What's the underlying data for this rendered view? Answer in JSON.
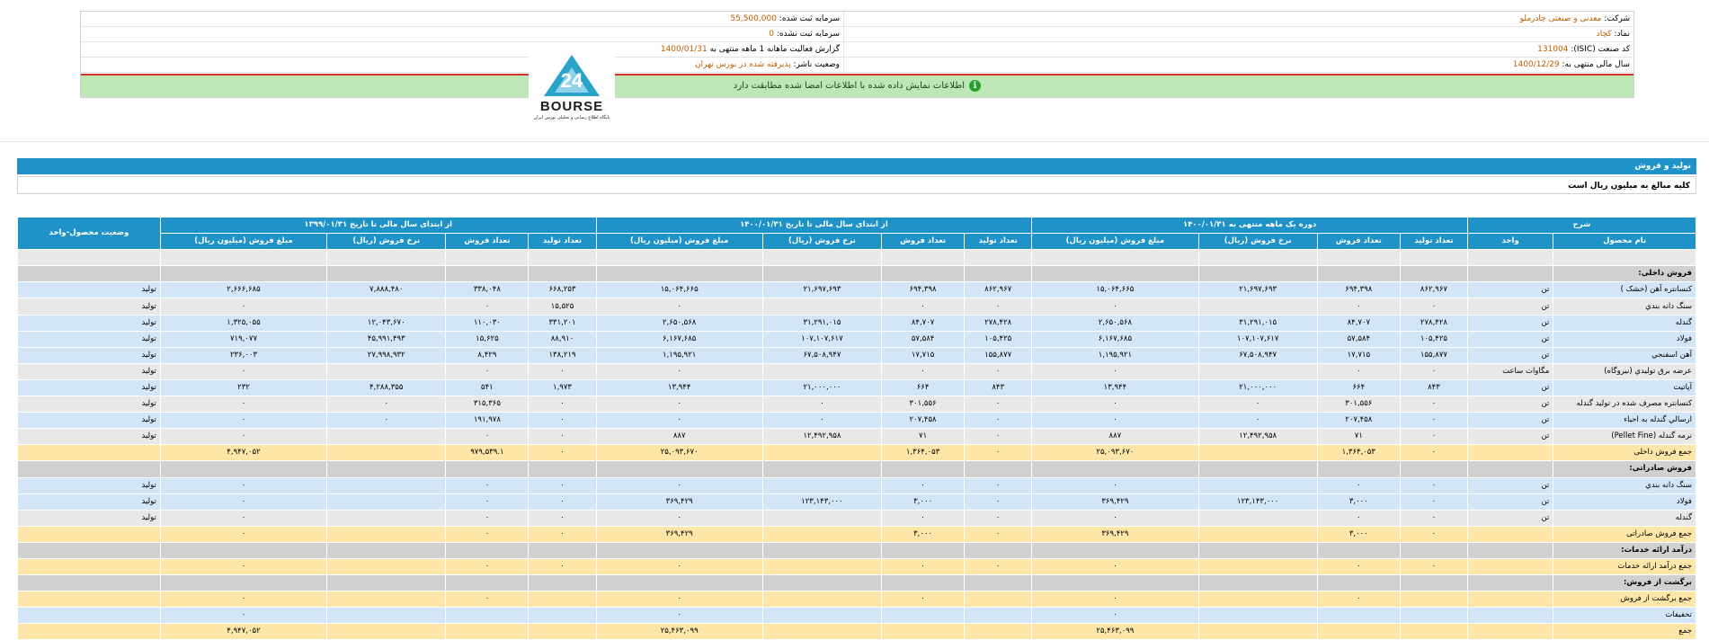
{
  "header": {
    "right": [
      {
        "label": "شرکت:",
        "value": "معدنی و صنعتی چادرملو"
      },
      {
        "label": "نماد:",
        "value": "کچاد"
      },
      {
        "label": "کد صنعت (ISIC):",
        "value": "131004"
      },
      {
        "label": "سال مالی منتهی به:",
        "value": "1400/12/29"
      }
    ],
    "left": [
      {
        "label": "سرمایه ثبت شده:",
        "value": "55,500,000"
      },
      {
        "label": "سرمایه ثبت نشده:",
        "value": "0"
      },
      {
        "label": "گزارش فعالیت ماهانه 1 ماهه منتهی به",
        "value": "1400/01/31"
      },
      {
        "label": "وضعیت ناشر:",
        "value": "پذیرفته شده در بورس تهران"
      }
    ],
    "notice": "اطلاعات نمایش داده شده با اطلاعات امضا شده مطابقت دارد",
    "notice_icon": "info-icon"
  },
  "logo": {
    "text": "BOURSE",
    "sub": "پایگاه اطلاع رسانی و تحلیلی بورس ایران"
  },
  "section_title": "تولید و فروش",
  "amount_note": "کلیه مبالغ به میلیون ریال است",
  "table": {
    "group_headers": [
      "شرح",
      "دوره یک ماهه منتهی به ۱۴۰۰/۰۱/۳۱",
      "از ابتدای سال مالی تا تاریخ ۱۴۰۰/۰۱/۳۱",
      "از ابتدای سال مالی تا تاریخ ۱۳۹۹/۰۱/۳۱",
      "وضعیت محصول-واحد"
    ],
    "sub_headers": [
      "نام محصول",
      "واحد",
      "تعداد تولید",
      "تعداد فروش",
      "نرخ فروش (ریال)",
      "مبلغ فروش (میلیون ریال)",
      "تعداد تولید",
      "تعداد فروش",
      "نرخ فروش (ریال)",
      "مبلغ فروش (میلیون ریال)",
      "تعداد تولید",
      "تعداد فروش",
      "نرخ فروش (ریال)",
      "مبلغ فروش (میلیون ریال)"
    ],
    "rows": [
      {
        "type": "gray",
        "cells": [
          "",
          "",
          "",
          "",
          "",
          "",
          "",
          "",
          "",
          "",
          "",
          "",
          "",
          "",
          ""
        ]
      },
      {
        "type": "head",
        "cells": [
          "فروش داخلی:",
          "",
          "",
          "",
          "",
          "",
          "",
          "",
          "",
          "",
          "",
          "",
          "",
          "",
          ""
        ]
      },
      {
        "type": "blue",
        "cells": [
          "کنسانتره آهن (خشک )",
          "تن",
          "۸۶۲,۹۶۷",
          "۶۹۴,۳۹۸",
          "۲۱,۶۹۷,۶۹۳",
          "۱۵,۰۶۴,۶۶۵",
          "۸۶۲,۹۶۷",
          "۶۹۴,۳۹۸",
          "۲۱,۶۹۷,۶۹۳",
          "۱۵,۰۶۴,۶۶۵",
          "۶۶۸,۲۵۳",
          "۳۳۸,۰۴۸",
          "۷,۸۸۸,۴۸۰",
          "۲,۶۶۶,۶۸۵",
          "تولید"
        ]
      },
      {
        "type": "gray",
        "cells": [
          "سنگ دانه بندي",
          "تن",
          "۰",
          "۰",
          "",
          "۰",
          "۰",
          "۰",
          "",
          "۰",
          "۱۵,۵۲۵",
          "۰",
          "",
          "۰",
          "تولید"
        ]
      },
      {
        "type": "blue",
        "cells": [
          "گندله",
          "تن",
          "۲۷۸,۴۲۸",
          "۸۴,۷۰۷",
          "۳۱,۲۹۱,۰۱۵",
          "۲,۶۵۰,۵۶۸",
          "۲۷۸,۴۲۸",
          "۸۴,۷۰۷",
          "۳۱,۲۹۱,۰۱۵",
          "۲,۶۵۰,۵۶۸",
          "۳۳۱,۲۰۱",
          "۱۱۰,۰۳۰",
          "۱۲,۰۴۳,۶۷۰",
          "۱,۳۲۵,۰۵۵",
          "تولید"
        ]
      },
      {
        "type": "blue",
        "cells": [
          "فولاد",
          "تن",
          "۱۰۵,۴۲۵",
          "۵۷,۵۸۴",
          "۱۰۷,۱۰۷,۶۱۷",
          "۶,۱۶۷,۶۸۵",
          "۱۰۵,۴۲۵",
          "۵۷,۵۸۴",
          "۱۰۷,۱۰۷,۶۱۷",
          "۶,۱۶۷,۶۸۵",
          "۸۸,۹۱۰",
          "۱۵,۶۲۵",
          "۴۵,۹۹۱,۴۹۳",
          "۷۱۹,۰۷۷",
          "تولید"
        ]
      },
      {
        "type": "blue",
        "cells": [
          "آهن اسفنجي",
          "تن",
          "۱۵۵,۸۷۷",
          "۱۷,۷۱۵",
          "۶۷,۵۰۸,۹۴۷",
          "۱,۱۹۵,۹۲۱",
          "۱۵۵,۸۷۷",
          "۱۷,۷۱۵",
          "۶۷,۵۰۸,۹۴۷",
          "۱,۱۹۵,۹۲۱",
          "۱۳۸,۲۱۹",
          "۸,۴۲۹",
          "۲۷,۹۹۸,۹۳۲",
          "۲۳۶,۰۰۳",
          "تولید"
        ]
      },
      {
        "type": "gray",
        "cells": [
          "عرضه برق توليدي (نيروگاه)",
          "مگاوات ساعت",
          "۰",
          "۰",
          "",
          "۰",
          "۰",
          "۰",
          "",
          "۰",
          "۰",
          "۰",
          "",
          "۰",
          "تولید"
        ]
      },
      {
        "type": "blue",
        "cells": [
          "آپاتيت",
          "تن",
          "۸۴۳",
          "۶۶۴",
          "۲۱,۰۰۰,۰۰۰",
          "۱۳,۹۴۴",
          "۸۴۳",
          "۶۶۴",
          "۲۱,۰۰۰,۰۰۰",
          "۱۳,۹۴۴",
          "۱,۹۷۳",
          "۵۴۱",
          "۴,۲۸۸,۳۵۵",
          "۲۳۲",
          "تولید"
        ]
      },
      {
        "type": "gray",
        "cells": [
          "کنسانتره مصرف شده در تولید گندله",
          "تن",
          "۰",
          "۳۰۱,۵۵۶",
          "۰",
          "۰",
          "۰",
          "۳۰۱,۵۵۶",
          "۰",
          "۰",
          "۰",
          "۳۱۵,۳۶۵",
          "۰",
          "۰",
          "تولید"
        ]
      },
      {
        "type": "blue",
        "cells": [
          "ارسالي گندله به احياء",
          "تن",
          "۰",
          "۲۰۷,۴۵۸",
          "۰",
          "۰",
          "۰",
          "۲۰۷,۴۵۸",
          "۰",
          "۰",
          "۰",
          "۱۹۱,۹۷۸",
          "۰",
          "۰",
          "تولید"
        ]
      },
      {
        "type": "gray",
        "cells": [
          "نرمه گندله (Pellet Fine)",
          "تن",
          "۰",
          "۷۱",
          "۱۲,۴۹۲,۹۵۸",
          "۸۸۷",
          "۰",
          "۷۱",
          "۱۲,۴۹۲,۹۵۸",
          "۸۸۷",
          "۰",
          "۰",
          "",
          "۰",
          "تولید"
        ]
      },
      {
        "type": "total",
        "cells": [
          "جمع فروش داخلی",
          "",
          "۰",
          "۱,۳۶۴,۰۵۳",
          "",
          "۲۵,۰۹۳,۶۷۰",
          "۰",
          "۱,۳۶۴,۰۵۳",
          "",
          "۲۵,۰۹۳,۶۷۰",
          "۰",
          "۹۷۹,۵۳۹.۱",
          "",
          "۴,۹۴۷,۰۵۲",
          ""
        ]
      },
      {
        "type": "head",
        "cells": [
          "فروش صادراتی:",
          "",
          "",
          "",
          "",
          "",
          "",
          "",
          "",
          "",
          "",
          "",
          "",
          "",
          ""
        ]
      },
      {
        "type": "blue",
        "cells": [
          "سنگ دانه بندي",
          "تن",
          "۰",
          "۰",
          "",
          "۰",
          "۰",
          "۰",
          "",
          "۰",
          "۰",
          "۰",
          "",
          "۰",
          "تولید"
        ]
      },
      {
        "type": "blue",
        "cells": [
          "فولاد",
          "تن",
          "۰",
          "۳,۰۰۰",
          "۱۲۳,۱۴۳,۰۰۰",
          "۳۶۹,۴۲۹",
          "۰",
          "۳,۰۰۰",
          "۱۲۳,۱۴۳,۰۰۰",
          "۳۶۹,۴۲۹",
          "۰",
          "۰",
          "",
          "۰",
          "تولید"
        ]
      },
      {
        "type": "gray",
        "cells": [
          "گندله",
          "تن",
          "۰",
          "۰",
          "",
          "۰",
          "۰",
          "۰",
          "",
          "۰",
          "۰",
          "۰",
          "",
          "۰",
          "تولید"
        ]
      },
      {
        "type": "total",
        "cells": [
          "جمع فروش صادراتی",
          "",
          "۰",
          "۳,۰۰۰",
          "",
          "۳۶۹,۴۲۹",
          "۰",
          "۳,۰۰۰",
          "",
          "۳۶۹,۴۲۹",
          "۰",
          "۰",
          "",
          "۰",
          ""
        ]
      },
      {
        "type": "head",
        "cells": [
          "درآمد ارائه خدمات:",
          "",
          "",
          "",
          "",
          "",
          "",
          "",
          "",
          "",
          "",
          "",
          "",
          "",
          ""
        ]
      },
      {
        "type": "total",
        "cells": [
          "جمع درآمد ارائه خدمات",
          "",
          "۰",
          "۰",
          "",
          "۰",
          "۰",
          "۰",
          "",
          "۰",
          "۰",
          "۰",
          "",
          "۰",
          ""
        ]
      },
      {
        "type": "head",
        "cells": [
          "برگشت از فروش:",
          "",
          "",
          "",
          "",
          "",
          "",
          "",
          "",
          "",
          "",
          "",
          "",
          "",
          ""
        ]
      },
      {
        "type": "total",
        "cells": [
          "جمع برگشت از فروش",
          "",
          "",
          "۰",
          "",
          "۰",
          "",
          "۰",
          "",
          "۰",
          "",
          "۰",
          "",
          "۰",
          ""
        ]
      },
      {
        "type": "blue",
        "cells": [
          "تخفیفات",
          "",
          "",
          "",
          "",
          "۰",
          "",
          "",
          "",
          "۰",
          "",
          "",
          "",
          "۰",
          ""
        ]
      },
      {
        "type": "total",
        "cells": [
          "جمع",
          "",
          "",
          "",
          "",
          "۲۵,۴۶۳,۰۹۹",
          "",
          "",
          "",
          "۲۵,۴۶۳,۰۹۹",
          "",
          "",
          "",
          "۴,۹۴۷,۰۵۲",
          ""
        ]
      }
    ]
  },
  "colors": {
    "accent": "#1f93c7",
    "notice_bg": "#bde7b7",
    "total_bg": "#fde6a8",
    "row_blue": "#d3e6f7",
    "row_gray": "#e8e8e8"
  }
}
